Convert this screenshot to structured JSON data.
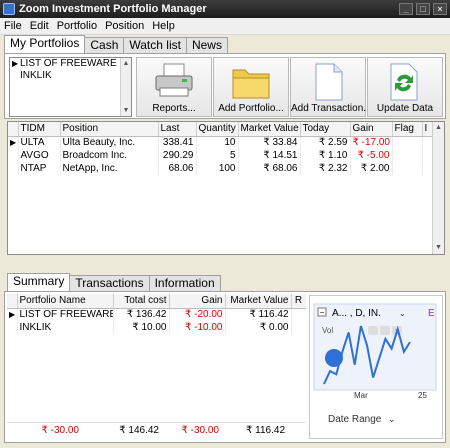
{
  "window": {
    "title": "Zoom Investment Portfolio Manager",
    "controls": [
      "_",
      "□",
      "×"
    ]
  },
  "menu": [
    "File",
    "Edit",
    "Portfolio",
    "Position",
    "Help"
  ],
  "tabs": [
    "My Portfolios",
    "Cash",
    "Watch list",
    "News"
  ],
  "portfolios": [
    "LIST OF FREEWARE",
    "INKLIK"
  ],
  "toolbar": {
    "reports": "Reports...",
    "add_portfolio": "Add Portfolio...",
    "add_transaction": "Add Transaction...",
    "update_data": "Update Data"
  },
  "positions": {
    "headers": [
      "TIDM",
      "Position",
      "Last",
      "Quantity",
      "Market Value",
      "Today",
      "Gain",
      "Flag",
      "I"
    ],
    "rows": [
      {
        "tidm": "ULTA",
        "name": "Ulta Beauty, Inc.",
        "last": "338.41",
        "qty": "10",
        "mv": "₹ 33.84",
        "today": "₹ 2.59",
        "gain": "₹ -17.00"
      },
      {
        "tidm": "AVGO",
        "name": "Broadcom Inc.",
        "last": "290.29",
        "qty": "5",
        "mv": "₹ 14.51",
        "today": "₹ 1.10",
        "gain": "₹ -5.00"
      },
      {
        "tidm": "NTAP",
        "name": "NetApp, Inc.",
        "last": "68.06",
        "qty": "100",
        "mv": "₹ 68.06",
        "today": "₹ 2.32",
        "gain": "₹ 2.00"
      }
    ]
  },
  "bottom_tabs": [
    "Summary",
    "Transactions",
    "Information"
  ],
  "summary": {
    "headers": [
      "Portfolio Name",
      "Total cost",
      "Gain",
      "Market Value",
      "R"
    ],
    "rows": [
      {
        "name": "LIST OF FREEWARE",
        "cost": "₹ 136.42",
        "gain": "₹ -20.00",
        "mv": "₹ 116.42"
      },
      {
        "name": "INKLIK",
        "cost": "₹ 10.00",
        "gain": "₹ -10.00",
        "mv": "₹ 0.00"
      }
    ],
    "totals": {
      "r": "₹ -30.00",
      "cost": "₹ 146.42",
      "gain": "₹ -30.00",
      "mv": "₹ 116.42"
    }
  },
  "mini_chart": {
    "title": "A... , D, IN.",
    "series_label": "Vol",
    "x_ticks": [
      "Mar",
      "25"
    ],
    "date_range": "Date Range",
    "chart_data": {
      "type": "line",
      "values": [
        6,
        10,
        9,
        16,
        22,
        12,
        24,
        18,
        8,
        14,
        20,
        17,
        23,
        16,
        19
      ],
      "xticks": [
        "Mar",
        "25"
      ]
    },
    "accent": "#2f6fd6"
  },
  "colors": {
    "negative": "#e00000"
  }
}
